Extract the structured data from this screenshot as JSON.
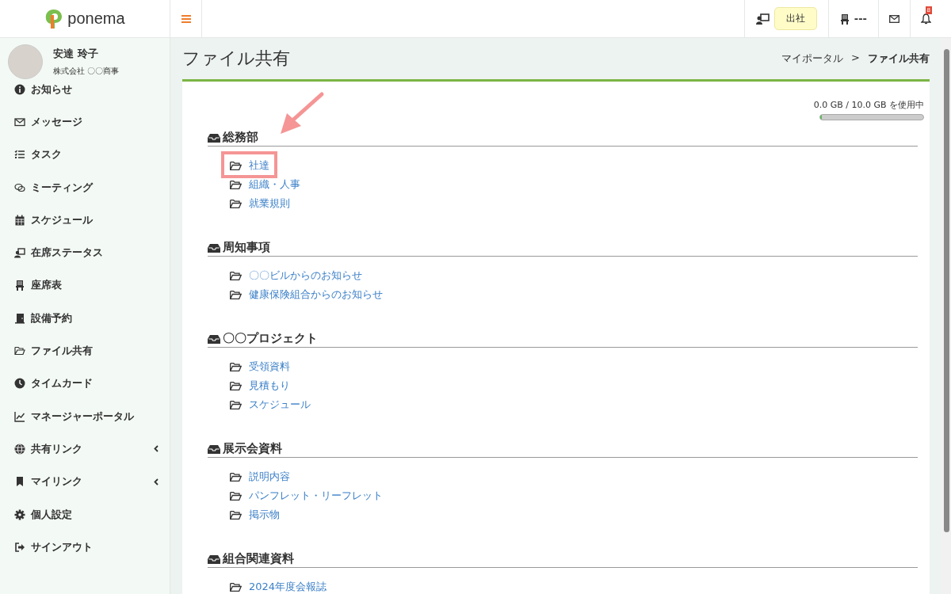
{
  "brand": {
    "name": "ponema"
  },
  "topbar": {
    "status": "出社",
    "seat": "---",
    "notifications": "8"
  },
  "user": {
    "name": "安達 玲子",
    "company": "株式会社 〇〇商事"
  },
  "sidebar": {
    "items": [
      {
        "label": "お知らせ",
        "has_submenu": false
      },
      {
        "label": "メッセージ",
        "has_submenu": false
      },
      {
        "label": "タスク",
        "has_submenu": false
      },
      {
        "label": "ミーティング",
        "has_submenu": false
      },
      {
        "label": "スケジュール",
        "has_submenu": false
      },
      {
        "label": "在席ステータス",
        "has_submenu": false
      },
      {
        "label": "座席表",
        "has_submenu": false
      },
      {
        "label": "設備予約",
        "has_submenu": false
      },
      {
        "label": "ファイル共有",
        "has_submenu": false
      },
      {
        "label": "タイムカード",
        "has_submenu": false
      },
      {
        "label": "マネージャーポータル",
        "has_submenu": false
      },
      {
        "label": "共有リンク",
        "has_submenu": true
      },
      {
        "label": "マイリンク",
        "has_submenu": true
      },
      {
        "label": "個人設定",
        "has_submenu": false
      },
      {
        "label": "サインアウト",
        "has_submenu": false
      }
    ]
  },
  "page": {
    "title": "ファイル共有",
    "breadcrumb": [
      "マイポータル",
      ">",
      "ファイル共有"
    ]
  },
  "storage": {
    "usage": "0.0 GB / 10.0 GB を使用中",
    "level": 0
  },
  "sections": [
    {
      "title": "総務部",
      "folders": [
        {
          "name": "社達",
          "highlighted": true
        },
        {
          "name": "組織・人事",
          "highlighted": false
        },
        {
          "name": "就業規則",
          "highlighted": false
        }
      ]
    },
    {
      "title": "周知事項",
      "folders": [
        {
          "name": "〇〇ビルからのお知らせ",
          "highlighted": false
        },
        {
          "name": "健康保険組合からのお知らせ",
          "highlighted": false
        }
      ]
    },
    {
      "title": "〇〇プロジェクト",
      "folders": [
        {
          "name": "受領資料",
          "highlighted": false
        },
        {
          "name": "見積もり",
          "highlighted": false
        },
        {
          "name": "スケジュール",
          "highlighted": false
        }
      ]
    },
    {
      "title": "展示会資料",
      "folders": [
        {
          "name": "説明内容",
          "highlighted": false
        },
        {
          "name": "パンフレット・リーフレット",
          "highlighted": false
        },
        {
          "name": "掲示物",
          "highlighted": false
        }
      ]
    },
    {
      "title": "組合関連資料",
      "folders": [
        {
          "name": "2024年度会報誌",
          "highlighted": false
        }
      ]
    }
  ]
}
